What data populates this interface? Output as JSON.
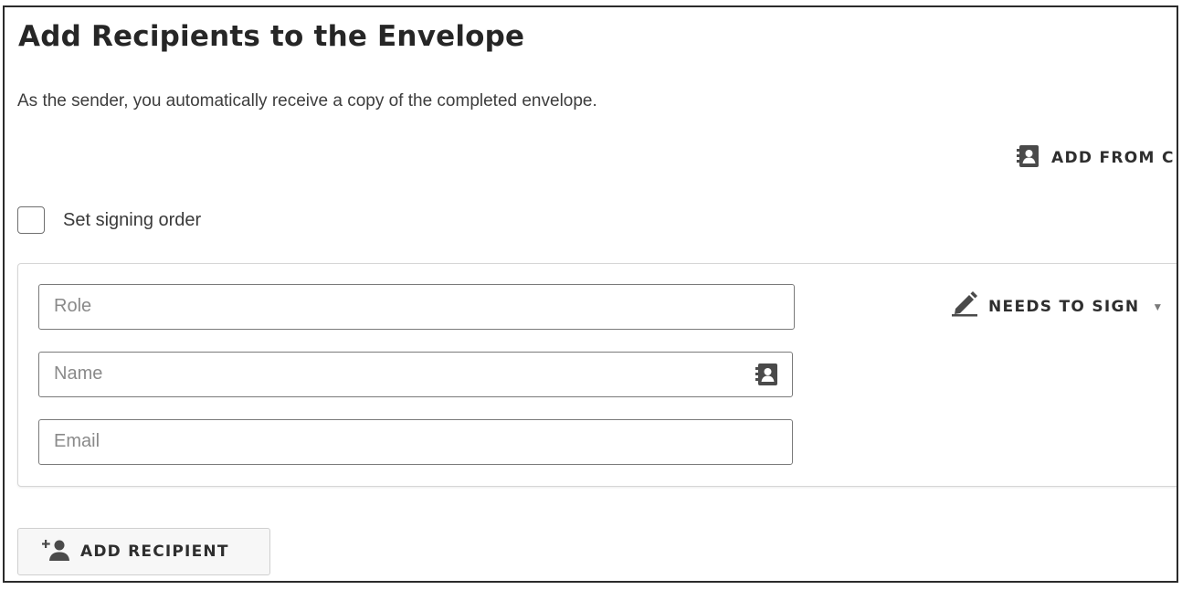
{
  "header": {
    "title": "Add Recipients to the Envelope",
    "subtitle": "As the sender, you automatically receive a copy of the completed envelope."
  },
  "toolbar": {
    "add_from_contacts_label": "ADD FROM C",
    "add_from_contacts_icon": "contact-card-icon"
  },
  "signing_order": {
    "label": "Set signing order",
    "checked": false
  },
  "recipient": {
    "role": {
      "placeholder": "Role",
      "value": ""
    },
    "name": {
      "placeholder": "Name",
      "value": "",
      "icon": "contact-card-icon"
    },
    "email": {
      "placeholder": "Email",
      "value": ""
    },
    "action": {
      "label": "NEEDS TO SIGN",
      "icon": "pen-icon",
      "caret": "▼"
    }
  },
  "footer": {
    "add_recipient_label": "ADD RECIPIENT",
    "add_recipient_icon": "add-person-icon"
  },
  "colors": {
    "text": "#333333",
    "icon": "#4a4a4a",
    "border": "#7a7a7a",
    "frame": "#2b2b2b"
  }
}
